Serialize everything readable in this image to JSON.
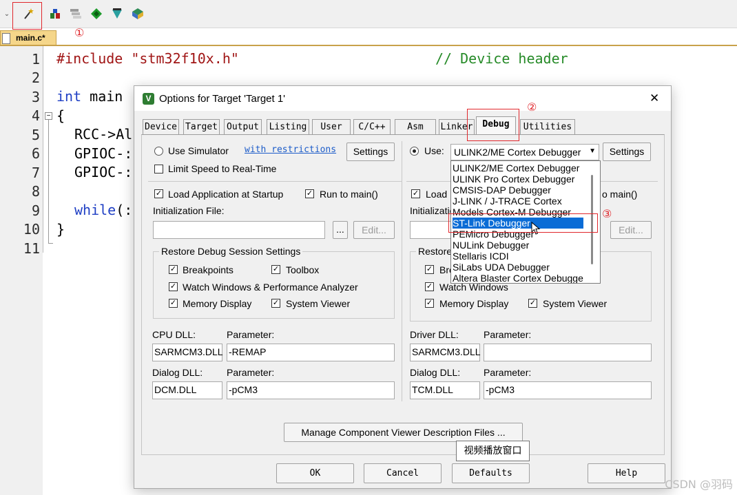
{
  "annotations": {
    "one": "①",
    "two": "②",
    "three": "③"
  },
  "file_tab": {
    "label": "main.c*"
  },
  "editor": {
    "line_numbers": [
      "1",
      "2",
      "3",
      "4",
      "5",
      "6",
      "7",
      "8",
      "9",
      "10",
      "11"
    ],
    "lines": {
      "l1_pp": "#include",
      "l1_str": "\"stm32f10x.h\"",
      "l1_cm": "// Device header",
      "l3_kw": "int",
      "l3_rest": " main",
      "l4": "{",
      "l5": "RCC->Al",
      "l6": "GPIOC-:",
      "l7": "GPIOC-:",
      "l9_kw": "while",
      "l9_rest": "(:",
      "l10": "}"
    }
  },
  "dialog": {
    "title": "Options for Target 'Target 1'",
    "close": "✕",
    "tabs": [
      "Device",
      "Target",
      "Output",
      "Listing",
      "User",
      "C/C++",
      "Asm",
      "Linker",
      "Debug",
      "Utilities"
    ],
    "left": {
      "use_simulator": "Use Simulator",
      "with_restrictions": "with restrictions",
      "settings": "Settings",
      "limit_speed": "Limit Speed to Real-Time",
      "load_app": "Load Application at Startup",
      "run_to_main": "Run to main()",
      "init_file": "Initialization File:",
      "browse": "...",
      "edit": "Edit...",
      "restore_title": "Restore Debug Session Settings",
      "breakpoints": "Breakpoints",
      "toolbox": "Toolbox",
      "watch": "Watch Windows & Performance Analyzer",
      "memory": "Memory Display",
      "system_viewer": "System Viewer",
      "cpu_dll_label": "CPU DLL:",
      "param_label": "Parameter:",
      "cpu_dll": "SARMCM3.DLL",
      "cpu_param": "-REMAP",
      "dialog_dll_label": "Dialog DLL:",
      "dialog_param_label": "Parameter:",
      "dialog_dll": "DCM.DLL",
      "dialog_param": "-pCM3"
    },
    "right": {
      "use": "Use:",
      "selected": "ULINK2/ME Cortex Debugger",
      "settings": "Settings",
      "load": "Load",
      "run_main_partial": "o main()",
      "init_partial": "Initializatio",
      "edit": "Edit...",
      "restore_partial": "Restore",
      "bre_partial": "Bre",
      "watch": "Watch Windows",
      "memory": "Memory Display",
      "system_viewer": "System Viewer",
      "driver_dll_label": "Driver DLL:",
      "param_label": "Parameter:",
      "driver_dll": "SARMCM3.DLL",
      "driver_param": "",
      "dialog_dll_label": "Dialog DLL:",
      "dialog_param_label": "Parameter:",
      "dialog_dll": "TCM.DLL",
      "dialog_param": "-pCM3"
    },
    "dropdown_options": [
      "ULINK2/ME Cortex Debugger",
      "ULINK Pro Cortex Debugger",
      "CMSIS-DAP Debugger",
      "J-LINK / J-TRACE Cortex",
      "Models Cortex-M Debugger",
      "ST-Link Debugger",
      "PEMicro Debugger",
      "NULink Debugger",
      "Stellaris ICDI",
      "SiLabs UDA Debugger",
      "Altera Blaster Cortex Debugger"
    ],
    "manage_btn": "Manage Component Viewer Description Files ...",
    "ok": "OK",
    "cancel": "Cancel",
    "defaults": "Defaults",
    "help": "Help"
  },
  "tooltip": "视频播放窗口",
  "watermark": "CSDN @羽码",
  "colors": {
    "accent_red": "#e0262b",
    "select_blue": "#0a6cd6"
  }
}
